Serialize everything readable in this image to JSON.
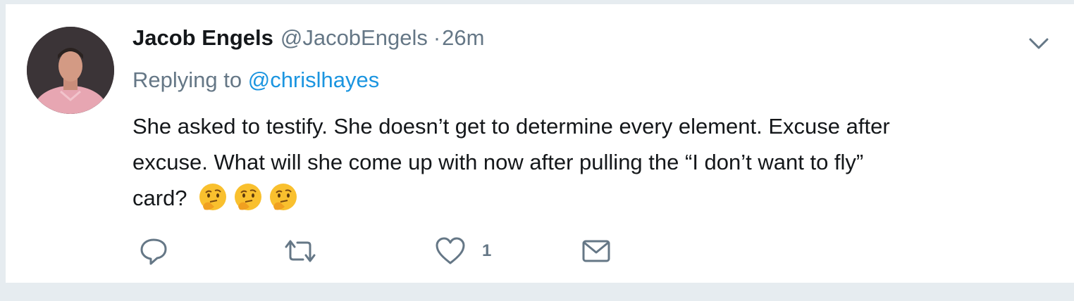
{
  "tweet": {
    "author": {
      "name": "Jacob Engels",
      "handle": "@JacobEngels",
      "avatar_icon": "profile-photo"
    },
    "separator": "·",
    "time": "26m",
    "replying": {
      "prefix": "Replying to ",
      "mention": "@chrislhayes"
    },
    "text_line1": "She asked to testify. She doesn’t get to determine every element. Excuse after",
    "text_line2": "excuse. What will she come up with now after pulling the “I don’t want to fly”",
    "text_line3": "card?",
    "emojis": [
      "thinking-face-emoji",
      "thinking-face-emoji",
      "thinking-face-emoji"
    ],
    "actions": {
      "reply_icon": "reply-icon",
      "retweet_icon": "retweet-icon",
      "like_icon": "heart-icon",
      "like_count": "1",
      "dm_icon": "envelope-icon"
    },
    "menu_icon": "chevron-down-icon"
  },
  "colors": {
    "text": "#14171a",
    "secondary": "#657786",
    "link": "#1b95e0",
    "background": "#e6ecf0"
  }
}
